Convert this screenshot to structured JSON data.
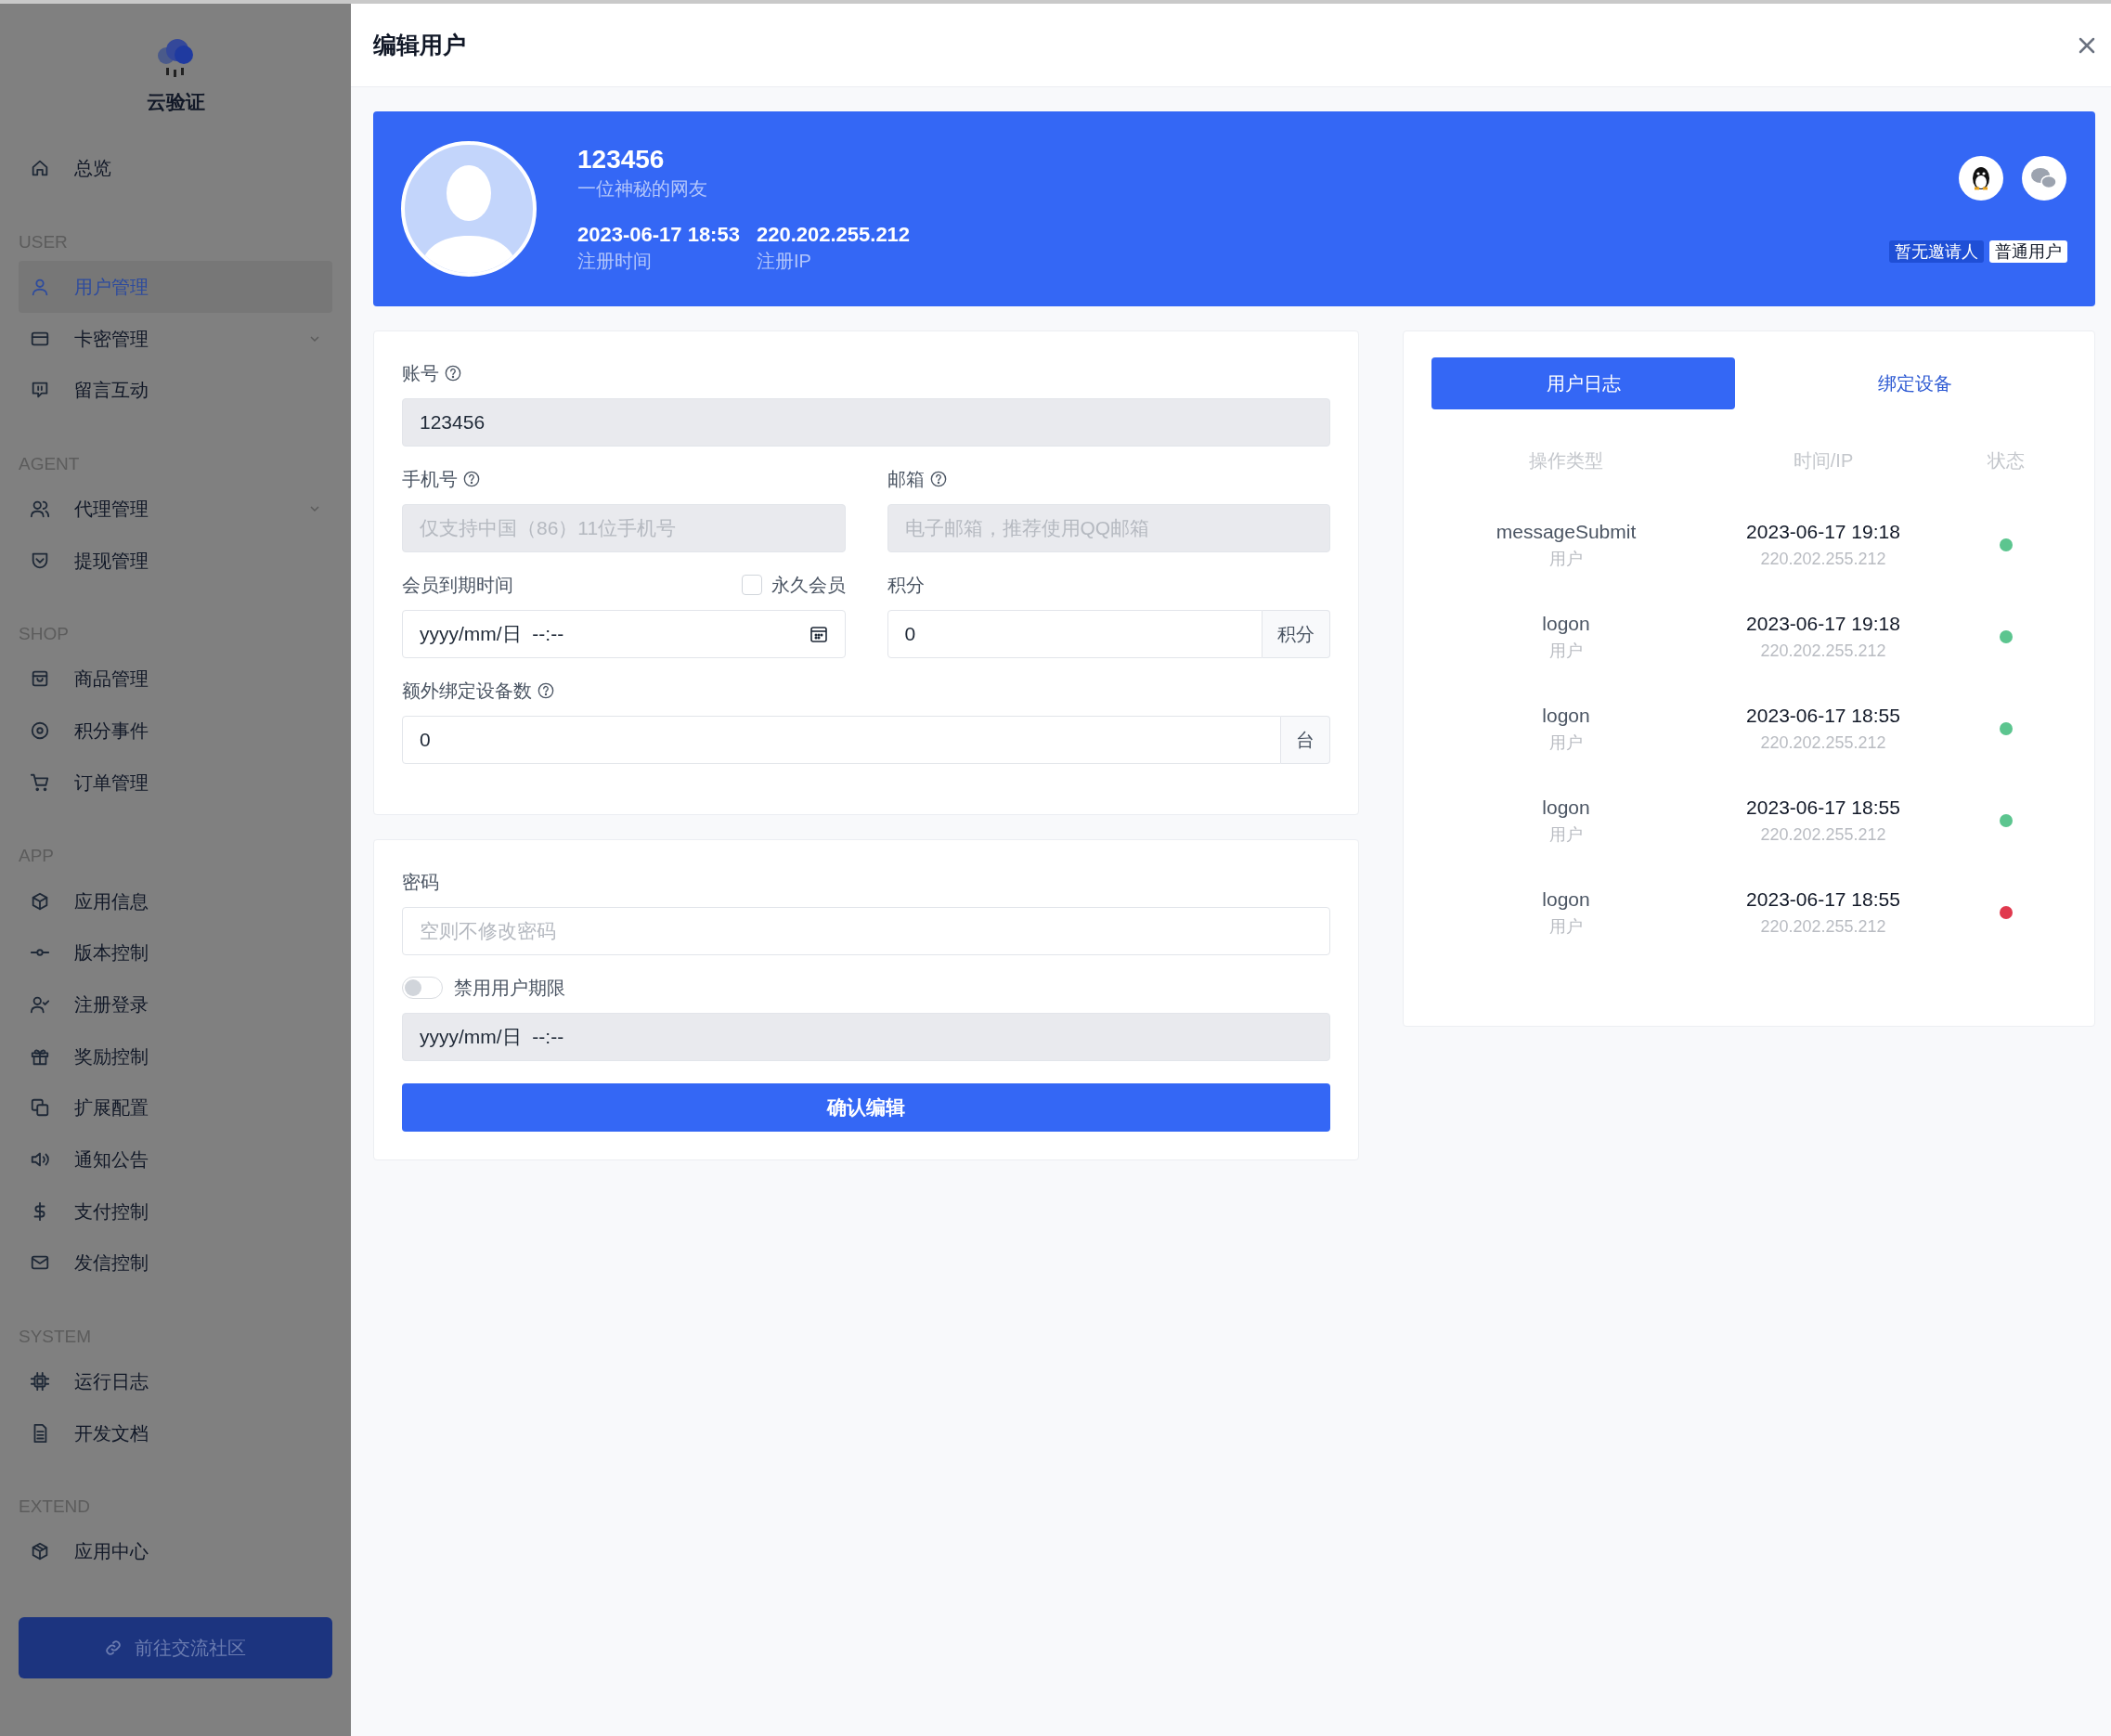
{
  "sidebar": {
    "app_name": "云验证",
    "nav": [
      {
        "kind": "item",
        "label": "总览",
        "selected": false,
        "expandable": false
      },
      {
        "kind": "section",
        "label": "USER"
      },
      {
        "kind": "item",
        "label": "用户管理",
        "selected": true,
        "expandable": false
      },
      {
        "kind": "item",
        "label": "卡密管理",
        "selected": false,
        "expandable": true
      },
      {
        "kind": "item",
        "label": "留言互动",
        "selected": false,
        "expandable": false
      },
      {
        "kind": "section",
        "label": "AGENT"
      },
      {
        "kind": "item",
        "label": "代理管理",
        "selected": false,
        "expandable": true
      },
      {
        "kind": "item",
        "label": "提现管理",
        "selected": false,
        "expandable": false
      },
      {
        "kind": "section",
        "label": "SHOP"
      },
      {
        "kind": "item",
        "label": "商品管理",
        "selected": false,
        "expandable": false
      },
      {
        "kind": "item",
        "label": "积分事件",
        "selected": false,
        "expandable": false
      },
      {
        "kind": "item",
        "label": "订单管理",
        "selected": false,
        "expandable": false
      },
      {
        "kind": "section",
        "label": "APP"
      },
      {
        "kind": "item",
        "label": "应用信息",
        "selected": false,
        "expandable": false
      },
      {
        "kind": "item",
        "label": "版本控制",
        "selected": false,
        "expandable": false
      },
      {
        "kind": "item",
        "label": "注册登录",
        "selected": false,
        "expandable": false
      },
      {
        "kind": "item",
        "label": "奖励控制",
        "selected": false,
        "expandable": false
      },
      {
        "kind": "item",
        "label": "扩展配置",
        "selected": false,
        "expandable": false
      },
      {
        "kind": "item",
        "label": "通知公告",
        "selected": false,
        "expandable": false
      },
      {
        "kind": "item",
        "label": "支付控制",
        "selected": false,
        "expandable": false
      },
      {
        "kind": "item",
        "label": "发信控制",
        "selected": false,
        "expandable": false
      },
      {
        "kind": "section",
        "label": "SYSTEM"
      },
      {
        "kind": "item",
        "label": "运行日志",
        "selected": false,
        "expandable": false
      },
      {
        "kind": "item",
        "label": "开发文档",
        "selected": false,
        "expandable": false
      },
      {
        "kind": "section",
        "label": "EXTEND"
      },
      {
        "kind": "item",
        "label": "应用中心",
        "selected": false,
        "expandable": false
      }
    ],
    "community_button": "前往交流社区"
  },
  "drawer": {
    "title": "编辑用户"
  },
  "profile": {
    "username": "123456",
    "nickname": "一位神秘的网友",
    "reg_time": "2023-06-17 18:53",
    "reg_time_label": "注册时间",
    "reg_ip": "220.202.255.212",
    "reg_ip_label": "注册IP",
    "badges": [
      {
        "label": "暂无邀请人",
        "kind": "dark"
      },
      {
        "label": "普通用户",
        "kind": "light"
      }
    ]
  },
  "form": {
    "account": {
      "label": "账号",
      "value": "123456",
      "disabled": true
    },
    "phone": {
      "label": "手机号",
      "placeholder": "仅支持中国（86）11位手机号",
      "disabled": true
    },
    "email": {
      "label": "邮箱",
      "placeholder": "电子邮箱，推荐使用QQ邮箱",
      "disabled": true
    },
    "expiry": {
      "label": "会员到期时间",
      "value": "yyyy/mm/日  --:--"
    },
    "permanent": {
      "label": "永久会员",
      "checked": false
    },
    "points": {
      "label": "积分",
      "value": "0",
      "unit": "积分"
    },
    "devices": {
      "label": "额外绑定设备数",
      "value": "0",
      "unit": "台"
    },
    "password": {
      "label": "密码",
      "placeholder": "空则不修改密码"
    },
    "ban": {
      "label": "禁用用户期限",
      "on": false,
      "value": "yyyy/mm/日  --:--"
    },
    "submit": "确认编辑"
  },
  "log": {
    "tabs": [
      {
        "label": "用户日志",
        "selected": true
      },
      {
        "label": "绑定设备",
        "selected": false
      }
    ],
    "columns": [
      "操作类型",
      "时间/IP",
      "状态"
    ],
    "rows": [
      {
        "action": "messageSubmit",
        "actor": "用户",
        "time": "2023-06-17 19:18",
        "ip": "220.202.255.212",
        "color": "#5cc58f"
      },
      {
        "action": "logon",
        "actor": "用户",
        "time": "2023-06-17 19:18",
        "ip": "220.202.255.212",
        "color": "#5cc58f"
      },
      {
        "action": "logon",
        "actor": "用户",
        "time": "2023-06-17 18:55",
        "ip": "220.202.255.212",
        "color": "#5cc58f"
      },
      {
        "action": "logon",
        "actor": "用户",
        "time": "2023-06-17 18:55",
        "ip": "220.202.255.212",
        "color": "#5cc58f"
      },
      {
        "action": "logon",
        "actor": "用户",
        "time": "2023-06-17 18:55",
        "ip": "220.202.255.212",
        "color": "#e0394e"
      }
    ]
  }
}
